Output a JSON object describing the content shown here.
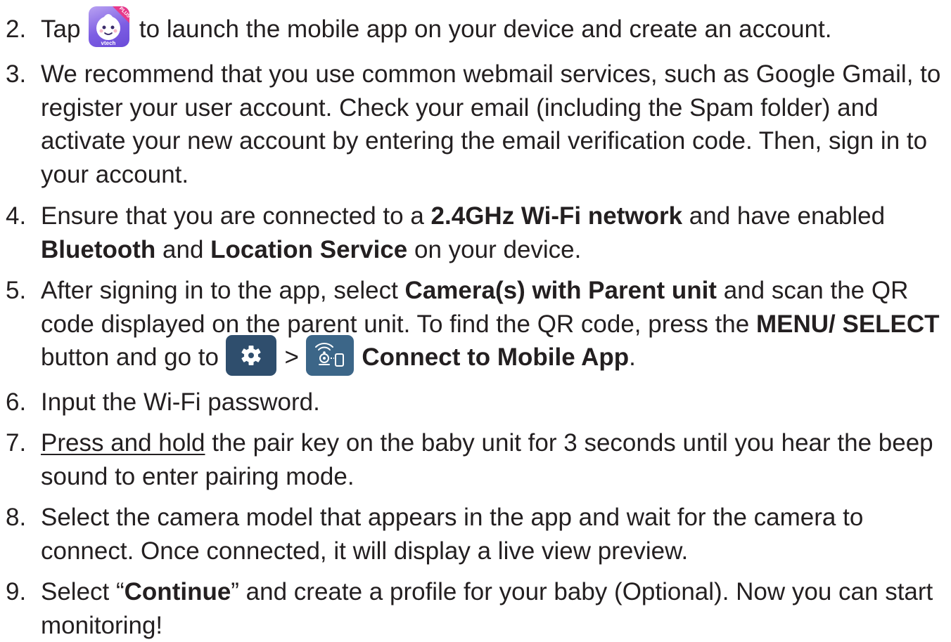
{
  "steps": [
    {
      "num": "2.",
      "parts": {
        "a": "Tap",
        "b": "to launch the mobile app on your device and create an account."
      }
    },
    {
      "num": "3.",
      "parts": {
        "a": "We recommend that you use common webmail services, such as Google Gmail, to register your user account. Check your email (including the Spam folder) and activate your new account by entering the email verification code. Then, sign in to your account."
      }
    },
    {
      "num": "4.",
      "parts": {
        "a": "Ensure that you are connected to a",
        "b": "2.4GHz Wi-Fi network",
        "c": "and have enabled",
        "d": "Bluetooth",
        "e": "and",
        "f": "Location Service",
        "g": "on your device."
      }
    },
    {
      "num": "5.",
      "parts": {
        "a": "After signing in to the app, select",
        "b": "Camera(s) with Parent unit",
        "c": "and scan the QR code displayed on the parent unit. To find the QR code, press the",
        "d": "MENU/ SELECT",
        "e": "button and go to",
        "f": ">",
        "g": "Connect to Mobile App",
        "h": "."
      }
    },
    {
      "num": "6.",
      "parts": {
        "a": "Input the Wi-Fi password."
      }
    },
    {
      "num": "7.",
      "parts": {
        "a": "Press and hold",
        "b": "the pair key on the baby unit for 3 seconds until you hear the beep sound to enter pairing mode."
      }
    },
    {
      "num": "8.",
      "parts": {
        "a": "Select the camera model that appears in the app and wait for the camera to connect. Once connected, it will display a live view preview."
      }
    },
    {
      "num": "9.",
      "parts": {
        "a": "Select “",
        "b": "Continue",
        "c": "” and create a profile for your baby (Optional). Now you can start monitoring!"
      }
    }
  ],
  "icons": {
    "app": {
      "name": "vtech-app-icon",
      "badge_text": "PLUS",
      "brand_text": "vtech"
    },
    "settings": {
      "name": "gear-icon"
    },
    "connect": {
      "name": "connect-to-mobile-app-icon"
    }
  }
}
